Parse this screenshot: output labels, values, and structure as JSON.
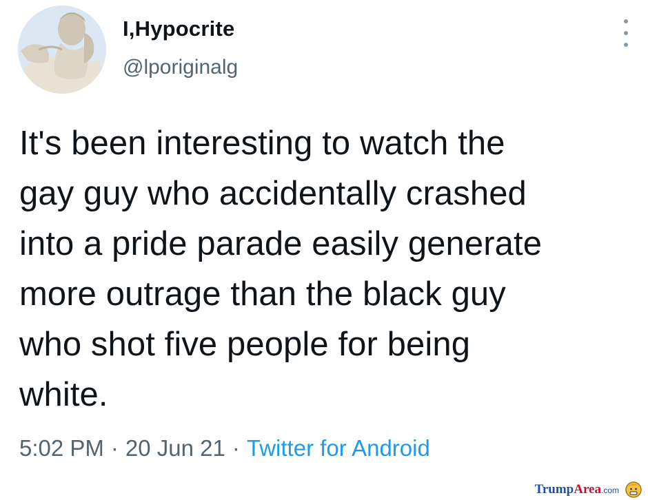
{
  "tweet": {
    "author": {
      "display_name": "I,Hypocrite",
      "handle": "@lporiginalg",
      "avatar_icon": "statue-avatar"
    },
    "text": "It's been interesting  to watch the\ngay guy who accidentally crashed\ninto a pride parade easily generate\nmore outrage than the black guy\nwho shot five people for being\nwhite.",
    "time": "5:02 PM",
    "date": "20 Jun 21",
    "separator": "·",
    "source": "Twitter for Android",
    "more_icon": "more-vertical-icon"
  },
  "watermark": {
    "brand_part1": "Trump",
    "brand_part2": "Area",
    "suffix": ".com"
  },
  "colors": {
    "text": "#0f1419",
    "secondary": "#536471",
    "link": "#1d9bf0"
  }
}
